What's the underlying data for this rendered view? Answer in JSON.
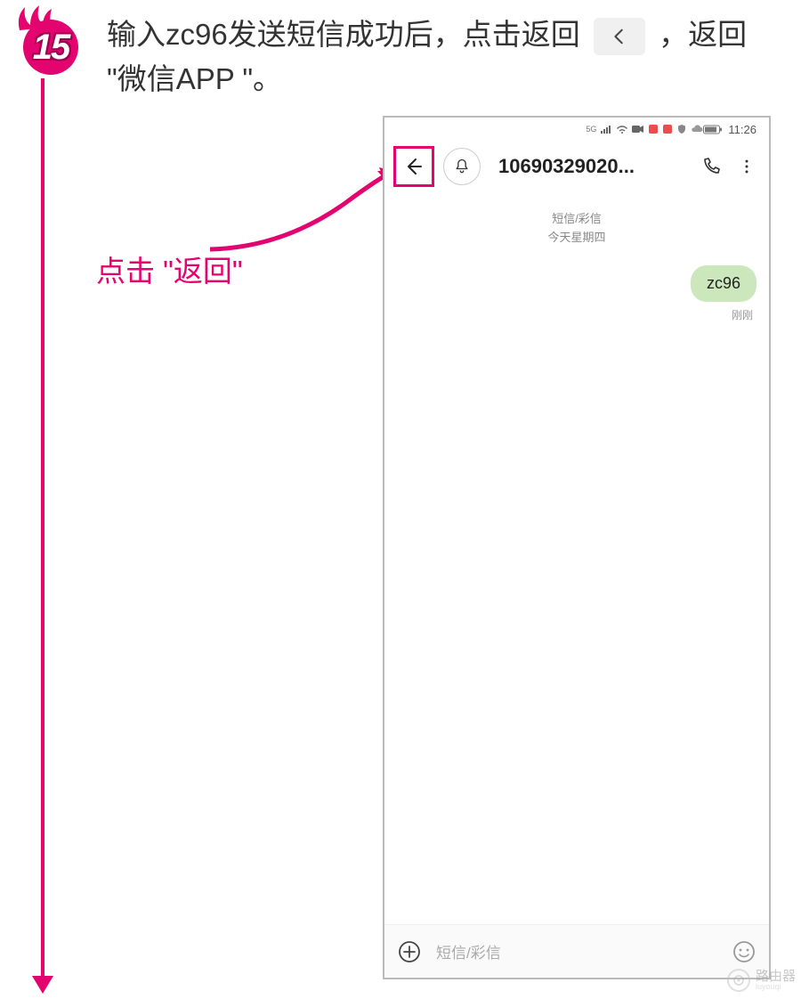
{
  "step": {
    "number": "15"
  },
  "instruction": {
    "part1": "输入zc96发送短信成功后，点击返回",
    "part2": "，返回 \"微信APP \"。"
  },
  "callout": {
    "text": "点击 \"返回\""
  },
  "phone": {
    "status": {
      "network": "5G",
      "time": "11:26"
    },
    "titlebar": {
      "contact": "10690329020..."
    },
    "messages": {
      "meta_line1": "短信/彩信",
      "meta_line2": "今天星期四",
      "bubble_text": "zc96",
      "time_label": "刚刚"
    },
    "compose": {
      "placeholder": "短信/彩信"
    }
  },
  "watermark": {
    "text": "路由器",
    "sub": "luyouqi"
  }
}
